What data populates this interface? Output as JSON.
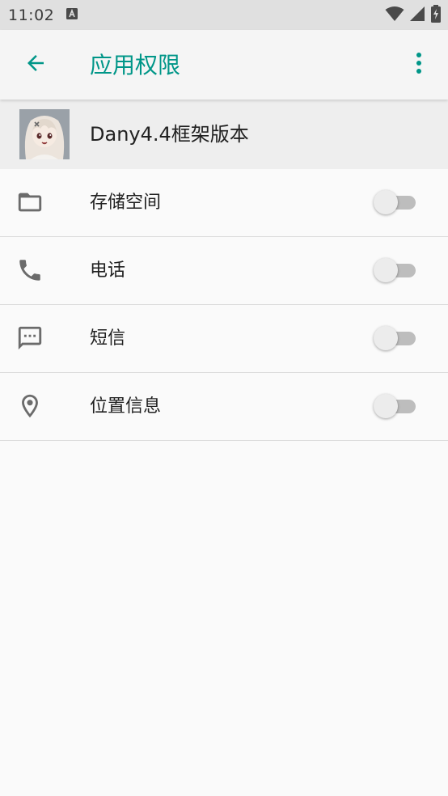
{
  "status_bar": {
    "time": "11:02",
    "notification_icon": "a-box-icon",
    "wifi_icon": "wifi-icon",
    "signal_icon": "cell-signal-icon",
    "battery_icon": "battery-charging-icon"
  },
  "app_bar": {
    "title": "应用权限",
    "back_icon": "arrow-back-icon",
    "menu_icon": "more-vert-icon",
    "accent_color": "#009688"
  },
  "app": {
    "name": "Dany4.4框架版本",
    "avatar_icon": "app-avatar-icon"
  },
  "permissions": [
    {
      "label": "存储空间",
      "icon": "folder-icon",
      "enabled": false
    },
    {
      "label": "电话",
      "icon": "phone-icon",
      "enabled": false
    },
    {
      "label": "短信",
      "icon": "sms-icon",
      "enabled": false
    },
    {
      "label": "位置信息",
      "icon": "location-icon",
      "enabled": false
    }
  ]
}
